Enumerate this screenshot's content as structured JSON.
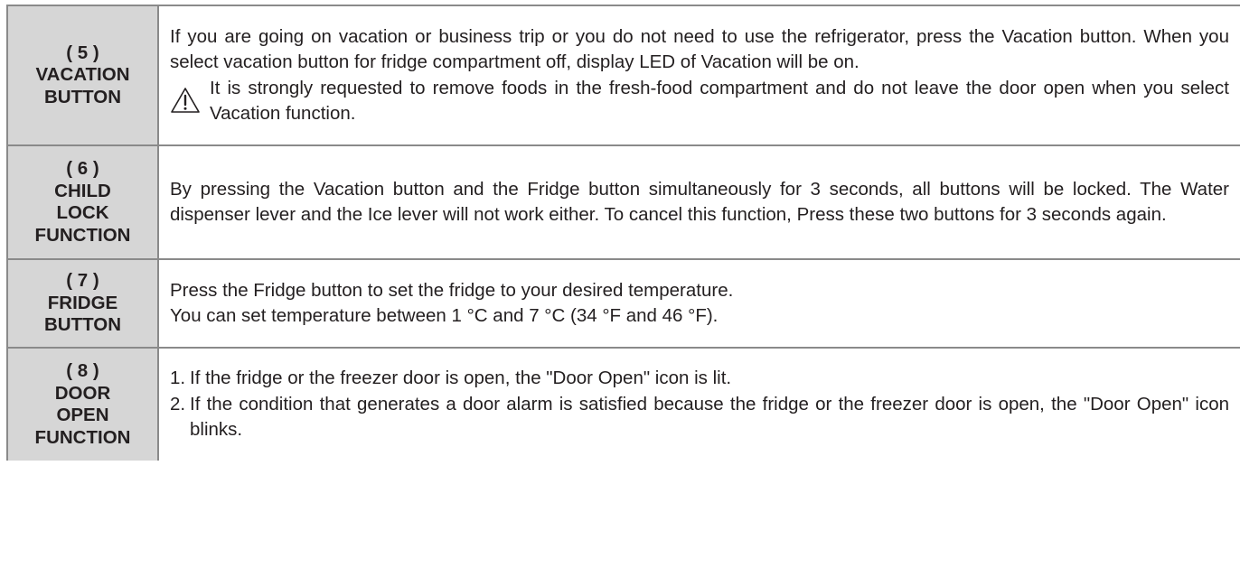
{
  "rows": [
    {
      "number": "( 5 )",
      "title_lines": [
        "VACATION",
        "BUTTON"
      ],
      "paragraphs": [
        "If you are going on vacation or business trip or you do not need to use the refrigerator, press the Vacation button. When you select vacation button for fridge compartment off, display LED of Vacation will be on."
      ],
      "warning": "It is strongly requested to remove foods in the fresh-food compartment and do not leave the door open when you select Vacation function."
    },
    {
      "number": "( 6 )",
      "title_lines": [
        "CHILD",
        "LOCK",
        "FUNCTION"
      ],
      "paragraphs": [
        "By pressing the Vacation button and the Fridge button simultaneously for 3 seconds, all buttons will be locked. The Water dispenser lever and the Ice lever will not work either. To cancel this function, Press these two buttons for 3 seconds again."
      ]
    },
    {
      "number": "( 7 )",
      "title_lines": [
        "FRIDGE",
        "BUTTON"
      ],
      "paragraphs": [
        "Press the Fridge button to set the fridge to your desired temperature.",
        "You can set temperature between 1 °C and 7 °C (34 °F and 46 °F)."
      ]
    },
    {
      "number": "( 8 )",
      "title_lines": [
        "DOOR",
        "OPEN",
        "FUNCTION"
      ],
      "list": [
        {
          "num": "1.",
          "text": "If the fridge or the freezer door is open, the \"Door Open\" icon is lit."
        },
        {
          "num": "2.",
          "text": "If the condition that generates a door alarm is satisfied because the fridge or the freezer door is open, the \"Door Open\" icon blinks."
        }
      ]
    }
  ],
  "icons": {
    "warning": "warning-triangle-icon"
  }
}
